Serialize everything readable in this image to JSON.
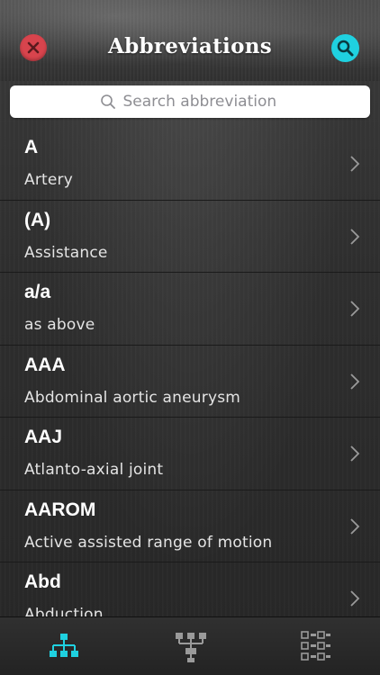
{
  "header": {
    "title": "Abbreviations",
    "close_icon": "close-icon",
    "search_icon": "search-icon",
    "colors": {
      "close": "#d8444d",
      "search": "#1fd1e0"
    }
  },
  "search": {
    "placeholder": "Search abbreviation",
    "value": ""
  },
  "list": {
    "items": [
      {
        "abbr": "A",
        "meaning": "Artery"
      },
      {
        "abbr": "(A)",
        "meaning": "Assistance"
      },
      {
        "abbr": "a/a",
        "meaning": "as above"
      },
      {
        "abbr": "AAA",
        "meaning": "Abdominal aortic aneurysm"
      },
      {
        "abbr": "AAJ",
        "meaning": "Atlanto-axial joint"
      },
      {
        "abbr": "AAROM",
        "meaning": "Active assisted range of motion"
      },
      {
        "abbr": "Abd",
        "meaning": "Abduction"
      }
    ]
  },
  "tabbar": {
    "tabs": [
      {
        "icon": "hierarchy-icon",
        "active": true
      },
      {
        "icon": "tree-icon",
        "active": false
      },
      {
        "icon": "checklist-icon",
        "active": false
      }
    ],
    "active_color": "#1fd1e0",
    "inactive_color": "#9a9a9a"
  }
}
